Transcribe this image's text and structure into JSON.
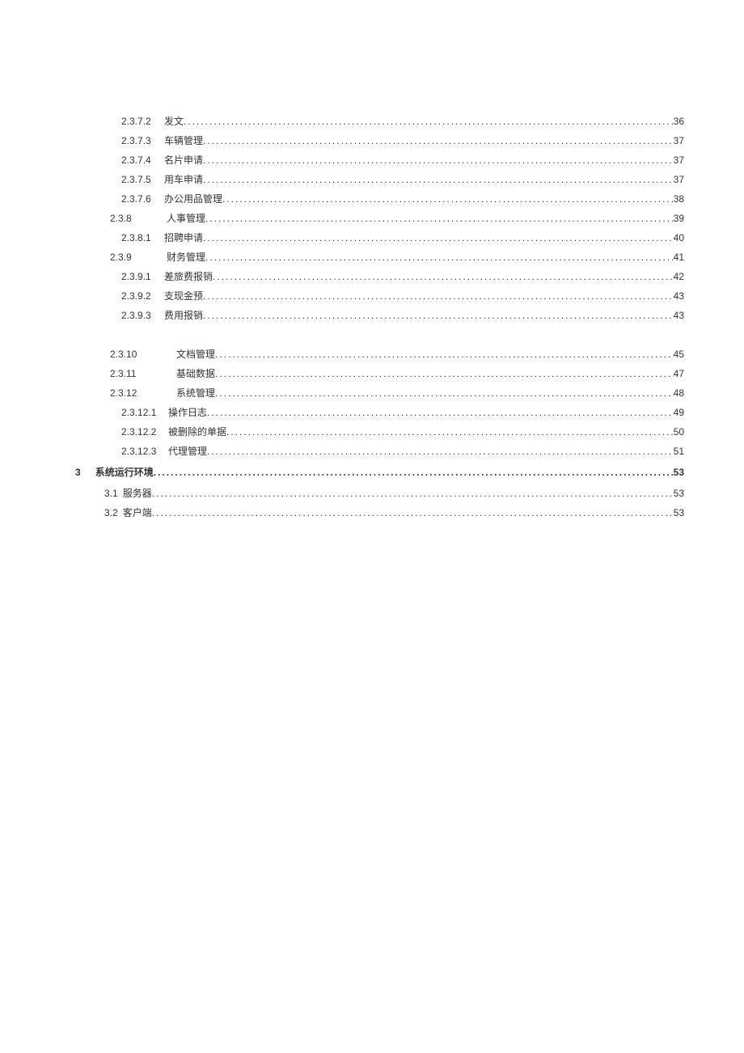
{
  "toc": [
    {
      "num": "2.3.7.2",
      "title": "发文",
      "page": "36",
      "cls": "indent-4 level-4"
    },
    {
      "num": "2.3.7.3",
      "title": "车辆管理",
      "page": "37",
      "cls": "indent-4 level-4"
    },
    {
      "num": "2.3.7.4",
      "title": "名片申请",
      "page": "37",
      "cls": "indent-4 level-4"
    },
    {
      "num": "2.3.7.5",
      "title": "用车申请",
      "page": "37",
      "cls": "indent-4 level-4"
    },
    {
      "num": "2.3.7.6",
      "title": "办公用品管理",
      "page": "38",
      "cls": "indent-4 level-4"
    },
    {
      "num": "2.3.8",
      "title": "人事管理",
      "page": "39",
      "cls": "indent-3 level-3"
    },
    {
      "num": "2.3.8.1",
      "title": "招聘申请",
      "page": "40",
      "cls": "indent-4 level-4"
    },
    {
      "num": "2.3.9",
      "title": "财务管理",
      "page": "41",
      "cls": "indent-3 level-3"
    },
    {
      "num": "2.3.9.1",
      "title": "差旅费报销",
      "page": "42",
      "cls": "indent-4 level-4"
    },
    {
      "num": "2.3.9.2",
      "title": "支现金预",
      "page": "43",
      "cls": "indent-4 level-4"
    },
    {
      "num": "2.3.9.3",
      "title": "费用报销",
      "page": "43",
      "cls": "indent-4 level-4"
    },
    {
      "spacer": true
    },
    {
      "num": "2.3.10",
      "title": "文档管理",
      "page": "45",
      "cls": "indent-3 level-3b"
    },
    {
      "num": "2.3.11",
      "title": "基础数据",
      "page": "47",
      "cls": "indent-3 level-3b"
    },
    {
      "num": "2.3.12",
      "title": "系统管理",
      "page": "48",
      "cls": "indent-3 level-3b"
    },
    {
      "num": "2.3.12.1",
      "title": "操作日志",
      "page": "49",
      "cls": "indent-4 level-4b"
    },
    {
      "num": "2.3.12.2",
      "title": "被删除的单据",
      "page": "50",
      "cls": "indent-4 level-4b"
    },
    {
      "num": "2.3.12.3",
      "title": "代理管理",
      "page": "51",
      "cls": "indent-4 level-4b"
    },
    {
      "num": "3",
      "title": "系统运行环境",
      "page": "53",
      "cls": "level-1 outdent section-gap"
    },
    {
      "num": "3.1",
      "title": "服务器",
      "page": "53",
      "cls": "level-2 section-gap"
    },
    {
      "num": "3.2",
      "title": "客户端",
      "page": "53",
      "cls": "level-2"
    }
  ]
}
